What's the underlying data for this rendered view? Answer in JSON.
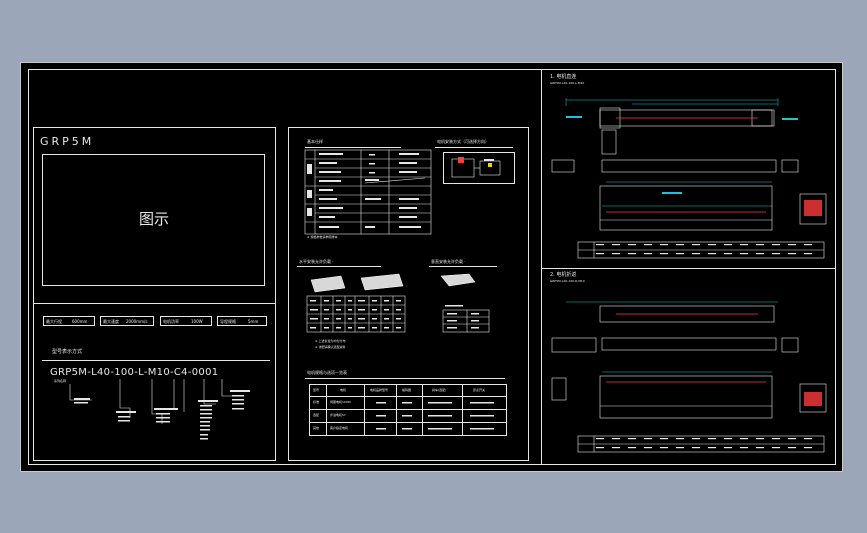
{
  "drawing": {
    "product_code": "GRP5M",
    "image_placeholder_label": "图示",
    "spec_boxes": [
      {
        "label": "最大行程",
        "value": "600mm"
      },
      {
        "label": "最大速度",
        "value": "2000mm/s"
      },
      {
        "label": "电机功率",
        "value": "100W"
      },
      {
        "label": "导程规格",
        "value": "5mm"
      }
    ],
    "model_notation_title": "型号表示方式",
    "model_code": "GRP5M-L40-100-L-M10-C4-0001",
    "model_code_first_label": "系列名称",
    "basic_specs_title": "基本仕样",
    "basic_specs_table_note": "※ 规格参数请参照样本",
    "motor_wiring_title": "电机安装方式（可选择方向）",
    "horizontal_load_title": "水平安装允许负载 ·",
    "vertical_load_title": "垂直安装允许负载 ·",
    "load_note_1": "※ 上述负载为均匀分布",
    "load_note_2": "※ 详细请确认选型资料",
    "options_table_title": "电机规格与选项一览表",
    "options_table_headers": [
      "型号",
      "电机",
      "电机品牌型号",
      "编码器",
      "刹车(选配)",
      "原点开关"
    ],
    "options_table_rows": [
      {
        "label": "标准",
        "model": "伺服电机100W"
      },
      {
        "label": "选配",
        "model": "步进电机57"
      },
      {
        "label": "其他",
        "model": "客户指定电机"
      }
    ],
    "section_1_title": "1. 电机直连",
    "section_1_subtitle": "GRP5M-L40-100-L-M10",
    "section_2_title": "2. 电机折返",
    "section_2_subtitle": "GRP5M-L40-100-R-M10"
  },
  "colors": {
    "background": "#9ba6b8",
    "sheet": "#000000",
    "line": "#e6e6e6",
    "dimension": "#18c6d6",
    "highlight": "#ff3b3b"
  }
}
